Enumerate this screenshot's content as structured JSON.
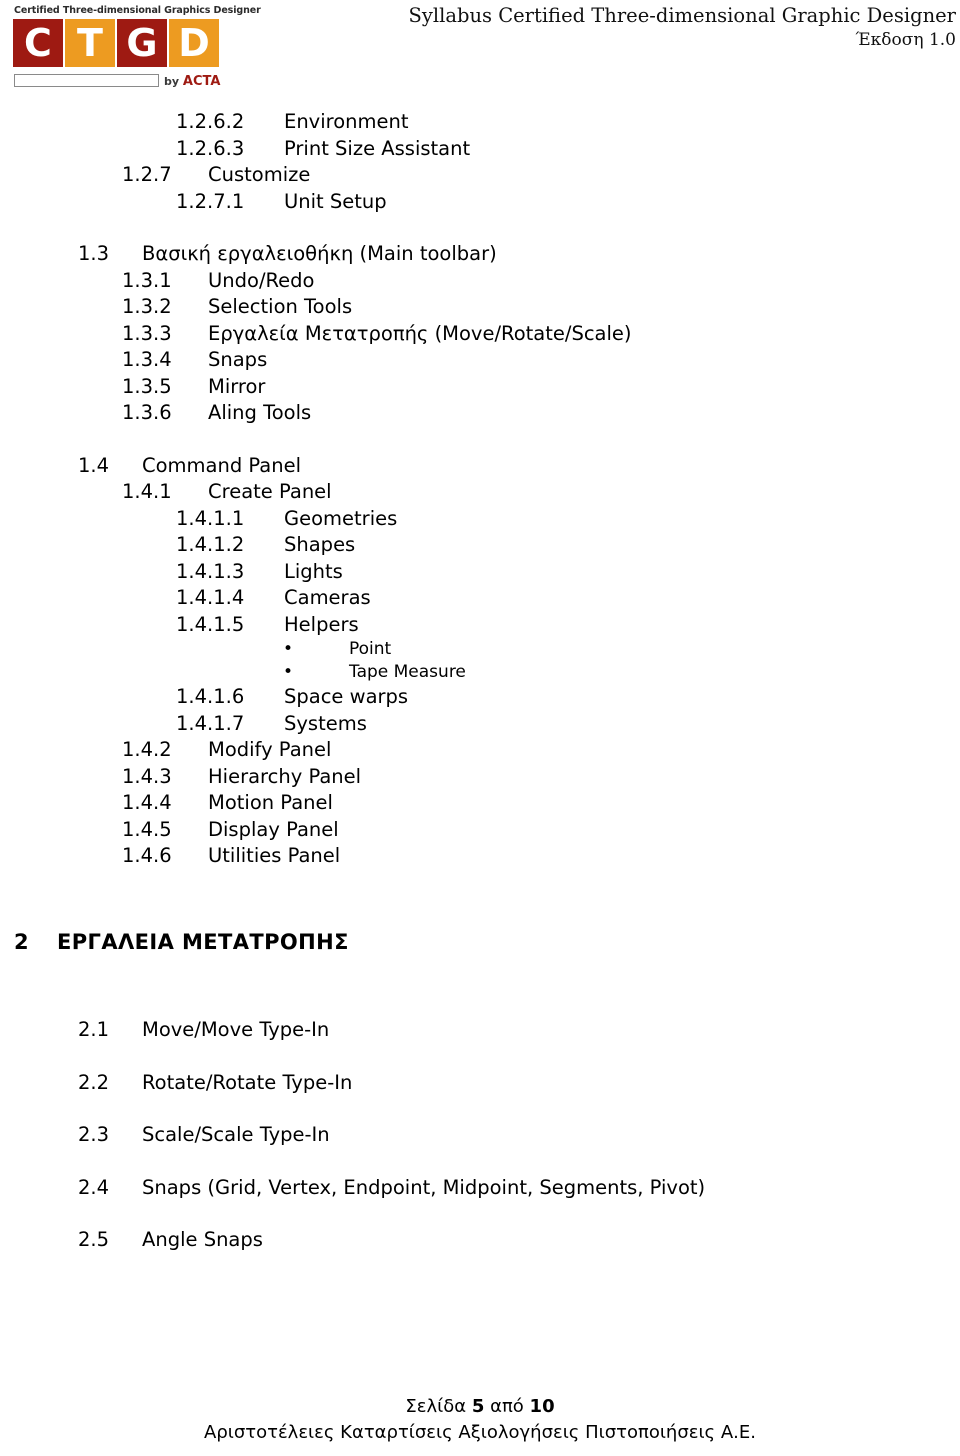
{
  "header": {
    "logo": {
      "tagline": "Certified Three-dimensional Graphics  Designer",
      "letters": [
        "C",
        "T",
        "G",
        "D"
      ],
      "by_label": "by",
      "brand": "ACTA",
      "color_red": "#9E1A12",
      "color_orange": "#ED9B21"
    },
    "title": "Syllabus Certified Three-dimensional Graphic Designer",
    "version": "Έκδοση 1.0"
  },
  "toc": {
    "rows": [
      {
        "level": 3,
        "number": "1.2.6.2",
        "label": "Environment",
        "gap": false
      },
      {
        "level": 3,
        "number": "1.2.6.3",
        "label": "Print Size Assistant",
        "gap": false
      },
      {
        "level": 2,
        "number": "1.2.7",
        "label": "Customize",
        "gap": false
      },
      {
        "level": 3,
        "number": "1.2.7.1",
        "label": "Unit Setup",
        "gap": false
      },
      {
        "level": 1,
        "number": "1.3",
        "label": "Βασική εργαλειοθήκη (Main toolbar)",
        "gap": true
      },
      {
        "level": 2,
        "number": "1.3.1",
        "label": "Undo/Redo",
        "gap": false
      },
      {
        "level": 2,
        "number": "1.3.2",
        "label": "Selection Tools",
        "gap": false
      },
      {
        "level": 2,
        "number": "1.3.3",
        "label": "Εργαλεία Μετατροπής (Move/Rotate/Scale)",
        "gap": false
      },
      {
        "level": 2,
        "number": "1.3.4",
        "label": "Snaps",
        "gap": false
      },
      {
        "level": 2,
        "number": "1.3.5",
        "label": "Mirror",
        "gap": false
      },
      {
        "level": 2,
        "number": "1.3.6",
        "label": "Aling Tools",
        "gap": false
      },
      {
        "level": 1,
        "number": "1.4",
        "label": "Command Panel",
        "gap": true
      },
      {
        "level": 2,
        "number": "1.4.1",
        "label": "Create Panel",
        "gap": false
      },
      {
        "level": 3,
        "number": "1.4.1.1",
        "label": "Geometries",
        "gap": false
      },
      {
        "level": 3,
        "number": "1.4.1.2",
        "label": "Shapes",
        "gap": false
      },
      {
        "level": 3,
        "number": "1.4.1.3",
        "label": "Lights",
        "gap": false
      },
      {
        "level": 3,
        "number": "1.4.1.4",
        "label": "Cameras",
        "gap": false
      },
      {
        "level": 3,
        "number": "1.4.1.5",
        "label": "Helpers",
        "gap": false
      },
      {
        "level": 0,
        "bullet": "•",
        "label": "Point"
      },
      {
        "level": 0,
        "bullet": "•",
        "label": "Tape Measure"
      },
      {
        "level": 3,
        "number": "1.4.1.6",
        "label": "Space warps",
        "gap": false
      },
      {
        "level": 3,
        "number": "1.4.1.7",
        "label": "Systems",
        "gap": false
      },
      {
        "level": 2,
        "number": "1.4.2",
        "label": "Modify Panel",
        "gap": false
      },
      {
        "level": 2,
        "number": "1.4.3",
        "label": "Hierarchy Panel",
        "gap": false
      },
      {
        "level": 2,
        "number": "1.4.4",
        "label": "Motion Panel",
        "gap": false
      },
      {
        "level": 2,
        "number": "1.4.5",
        "label": "Display Panel",
        "gap": false
      },
      {
        "level": 2,
        "number": "1.4.6",
        "label": "Utilities Panel",
        "gap": false
      }
    ]
  },
  "chapter2": {
    "number": "2",
    "label": "ΕΡΓΑΛΕΙΑ ΜΕΤΑΤΡΟΠΗΣ",
    "items": [
      {
        "number": "2.1",
        "label": "Move/Move Type-In"
      },
      {
        "number": "2.2",
        "label": "Rotate/Rotate Type-In"
      },
      {
        "number": "2.3",
        "label": "Scale/Scale Type-In"
      },
      {
        "number": "2.4",
        "label": "Snaps (Grid, Vertex, Endpoint, Midpoint, Segments, Pivot)"
      },
      {
        "number": "2.5",
        "label": "Angle Snaps"
      }
    ]
  },
  "footer": {
    "page_prefix": "Σελίδα ",
    "page_current": "5",
    "page_middle": " από ",
    "page_total": "10",
    "organization": "Αριστοτέλειες Καταρτίσεις Αξιολογήσεις  Πιστοποιήσεις Α.Ε."
  }
}
